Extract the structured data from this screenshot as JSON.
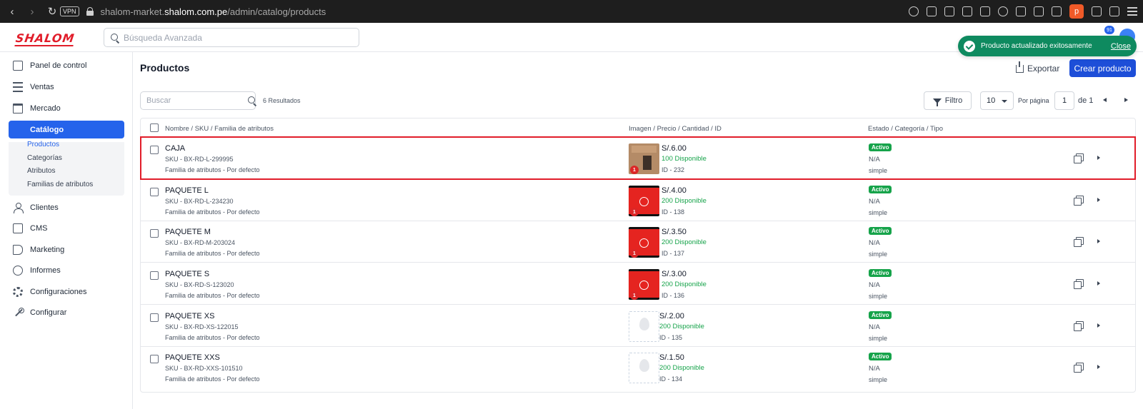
{
  "browser": {
    "vpn_label": "VPN",
    "url_prefix": "shalom-market.",
    "url_domain": "shalom.com.pe",
    "url_path": "/admin/catalog/products",
    "profile_initial": "p"
  },
  "header": {
    "logo_text": "SHALOM",
    "search_placeholder": "Búsqueda Avanzada",
    "notification_count": "91"
  },
  "toast": {
    "message": "Producto actualizado exitosamente",
    "close_label": "Close",
    "color": "#0e8a5f"
  },
  "sidebar": {
    "items": [
      {
        "label": "Panel de control",
        "icon": "dashboard-icon"
      },
      {
        "label": "Ventas",
        "icon": "sales-icon"
      },
      {
        "label": "Mercado",
        "icon": "store-icon"
      },
      {
        "label": "Catálogo",
        "icon": "catalog-icon"
      },
      {
        "label": "Clientes",
        "icon": "user-icon"
      },
      {
        "label": "CMS",
        "icon": "cms-icon"
      },
      {
        "label": "Marketing",
        "icon": "megaphone-icon"
      },
      {
        "label": "Informes",
        "icon": "chart-pie-icon"
      },
      {
        "label": "Configuraciones",
        "icon": "gear-icon"
      },
      {
        "label": "Configurar",
        "icon": "wrench-icon"
      }
    ],
    "catalog_sub": [
      "Productos",
      "Categorías",
      "Atributos",
      "Familias de atributos"
    ],
    "active_color": "#2563eb"
  },
  "page": {
    "title": "Productos",
    "export_label": "Exportar",
    "create_label": "Crear producto"
  },
  "toolbar": {
    "search_placeholder": "Buscar",
    "results": "6 Resultados",
    "filter_label": "Filtro",
    "per_page_value": "10",
    "per_page_label": "Por página",
    "page_value": "1",
    "page_of": "de 1"
  },
  "table": {
    "headers": [
      "Nombre / SKU / Familia de atributos",
      "Imagen / Precio / Cantidad / ID",
      "Estado / Categoría / Tipo"
    ],
    "rows": [
      {
        "name": "CAJA",
        "sku": "SKU - BX-RD-L-299995",
        "family": "Familia de atributos - Por defecto",
        "image": "box",
        "qty_badge": "1",
        "price": "S/.6.00",
        "stock": "100 Disponible",
        "id": "ID - 232",
        "status": "Activo",
        "category": "N/A",
        "type": "simple"
      },
      {
        "name": "PAQUETE L",
        "sku": "SKU - BX-RD-L-234230",
        "family": "Familia de atributos - Por defecto",
        "image": "red-bag",
        "qty_badge": "1",
        "price": "S/.4.00",
        "stock": "200 Disponible",
        "id": "ID - 138",
        "status": "Activo",
        "category": "N/A",
        "type": "simple"
      },
      {
        "name": "PAQUETE M",
        "sku": "SKU - BX-RD-M-203024",
        "family": "Familia de atributos - Por defecto",
        "image": "red-bag",
        "qty_badge": "1",
        "price": "S/.3.50",
        "stock": "200 Disponible",
        "id": "ID - 137",
        "status": "Activo",
        "category": "N/A",
        "type": "simple"
      },
      {
        "name": "PAQUETE S",
        "sku": "SKU - BX-RD-S-123020",
        "family": "Familia de atributos - Por defecto",
        "image": "red-bag",
        "qty_badge": "1",
        "price": "S/.3.00",
        "stock": "200 Disponible",
        "id": "ID - 136",
        "status": "Activo",
        "category": "N/A",
        "type": "simple"
      },
      {
        "name": "PAQUETE XS",
        "sku": "SKU - BX-RD-XS-122015",
        "family": "Familia de atributos - Por defecto",
        "image": "placeholder",
        "price": "S/.2.00",
        "stock": "200 Disponible",
        "id": "ID - 135",
        "status": "Activo",
        "category": "N/A",
        "type": "simple"
      },
      {
        "name": "PAQUETE XXS",
        "sku": "SKU - BX-RD-XXS-101510",
        "family": "Familia de atributos - Por defecto",
        "image": "placeholder",
        "price": "S/.1.50",
        "stock": "200 Disponible",
        "id": "ID - 134",
        "status": "Activo",
        "category": "N/A",
        "type": "simple"
      }
    ],
    "highlight_color": "#e11d2a",
    "status_color": "#16a34a"
  }
}
